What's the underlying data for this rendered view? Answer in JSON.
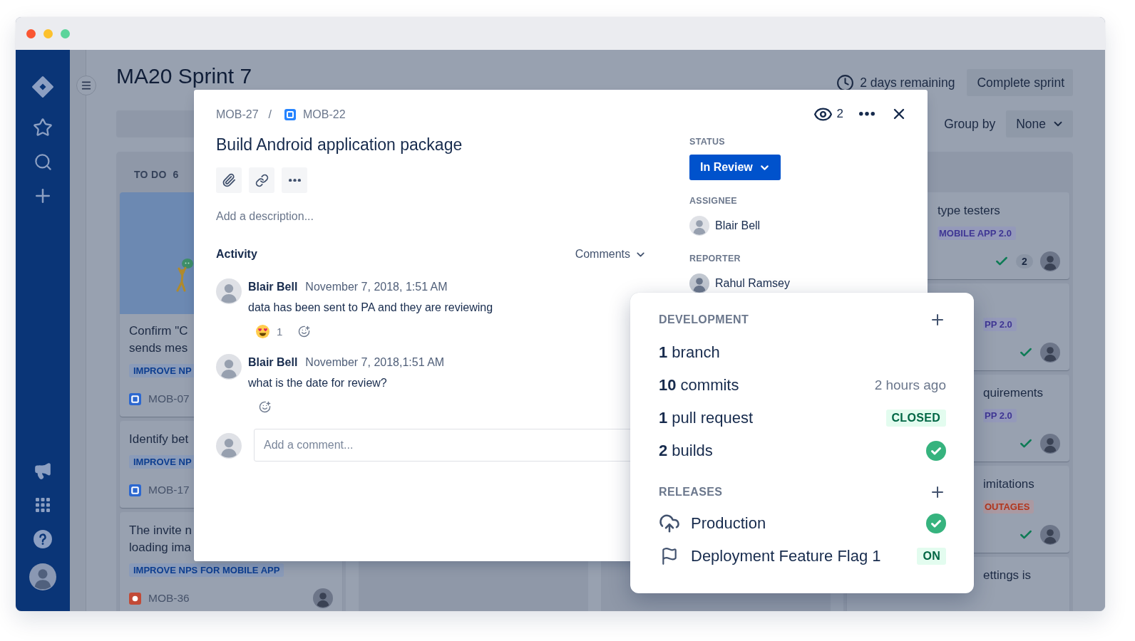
{
  "board": {
    "title": "MA20 Sprint 7",
    "time_remaining": "2 days remaining",
    "complete_button": "Complete sprint",
    "group_by": {
      "label": "Group by",
      "value": "None"
    },
    "column_1": {
      "header": "TO DO",
      "count": "6",
      "cards": [
        {
          "cover": true,
          "title": "Confirm \"C sends mes",
          "tag": {
            "text": "IMPROVE NP",
            "color": "#0c3d8f"
          },
          "issue": {
            "kind": "task",
            "key": "MOB-07"
          },
          "avatar": false
        },
        {
          "cover": false,
          "title": "Identify bet",
          "tag": {
            "text": "IMPROVE NP",
            "color": "#0c3d8f"
          },
          "issue": {
            "kind": "task",
            "key": "MOB-17"
          },
          "avatar": false
        },
        {
          "cover": false,
          "title": "The invite n loading ima",
          "tag": {
            "text": "IMPROVE NPS FOR MOBILE APP",
            "color": "#0c3d8f"
          },
          "issue": {
            "kind": "bug",
            "key": "MOB-36"
          },
          "avatar": true
        }
      ]
    },
    "column_4": {
      "cards": [
        {
          "title": "type testers",
          "tag": {
            "text": "MOBILE APP 2.0",
            "color": "#3f3694"
          },
          "done": true,
          "estimate": "2",
          "avatar": true
        },
        {
          "tag": {
            "text": "PP 2.0",
            "color": "#3f3694"
          },
          "done": true,
          "avatar": true
        },
        {
          "title": "quirements",
          "tag": {
            "text": "PP 2.0",
            "color": "#3f3694"
          },
          "done": true,
          "avatar": true
        },
        {
          "title": "imitations",
          "tag": {
            "text": "OUTAGES",
            "color": "#b2351c"
          },
          "done": true,
          "avatar": true
        },
        {
          "title": "ettings is",
          "done": false,
          "avatar": false
        }
      ]
    }
  },
  "issue": {
    "breadcrumb": {
      "parent": "MOB-27",
      "separator": "/",
      "current": {
        "kind": "task",
        "key": "MOB-22"
      }
    },
    "title": "Build Android application package",
    "description": {
      "placeholder": "Add a description..."
    },
    "activity": {
      "title": "Activity",
      "filter": "Comments"
    },
    "comments": [
      {
        "author": "Blair Bell",
        "time": "November 7, 2018, 1:51 AM",
        "body": "data has been sent to PA and they are reviewing",
        "reactions": [
          {
            "count": "1"
          }
        ]
      },
      {
        "author": "Blair Bell",
        "time": "November 7, 2018,1:51 AM",
        "body": "what is the date for review?"
      }
    ],
    "comment_box": {
      "placeholder": "Add a comment..."
    },
    "watchers": "2",
    "status": {
      "label": "STATUS",
      "value": "In Review"
    },
    "assignee": {
      "label": "ASSIGNEE",
      "name": "Blair Bell"
    },
    "reporter": {
      "label": "REPORTER",
      "name": "Rahul Ramsey"
    }
  },
  "development": {
    "title": "DEVELOPMENT",
    "items": [
      {
        "kind": "count",
        "label": "**1** branch"
      },
      {
        "kind": "time",
        "label": "**10** commits",
        "time": "2 hours ago"
      },
      {
        "kind": "badge",
        "label": "**1** pull request",
        "badge": "CLOSED"
      },
      {
        "kind": "status",
        "label": "**2** builds",
        "passed": true
      }
    ],
    "releases_title": "RELEASES",
    "releases": [
      {
        "kind": "deployment",
        "label": "Production",
        "passed": true
      },
      {
        "kind": "flag",
        "label": "Deployment Feature Flag 1",
        "badge": "ON"
      }
    ]
  }
}
